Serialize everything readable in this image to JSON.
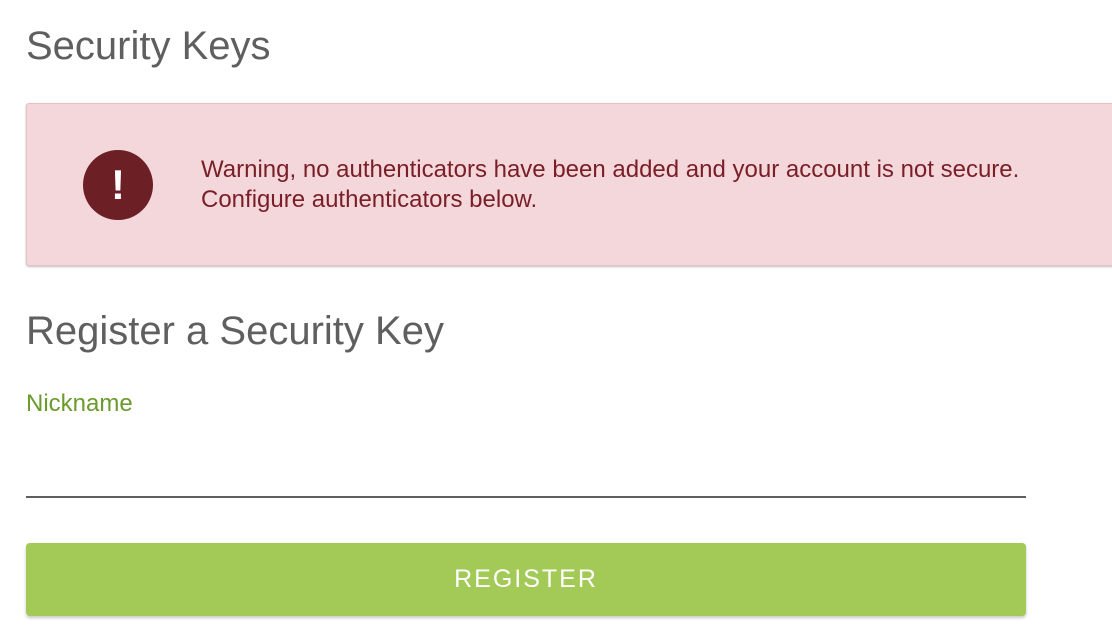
{
  "page": {
    "title": "Security Keys"
  },
  "alert": {
    "icon": "exclamation-icon",
    "icon_glyph": "!",
    "line1": "Warning, no authenticators have been added and your account is not secure.",
    "line2": "Configure authenticators below.",
    "background_color": "#f3d7db",
    "text_color": "#7a1e27",
    "icon_color": "#6c1f25"
  },
  "register": {
    "title": "Register a Security Key",
    "nickname_label": "Nickname",
    "nickname_value": "",
    "button_label": "REGISTER",
    "label_color": "#6a9b2b",
    "button_color": "#a3c957"
  }
}
